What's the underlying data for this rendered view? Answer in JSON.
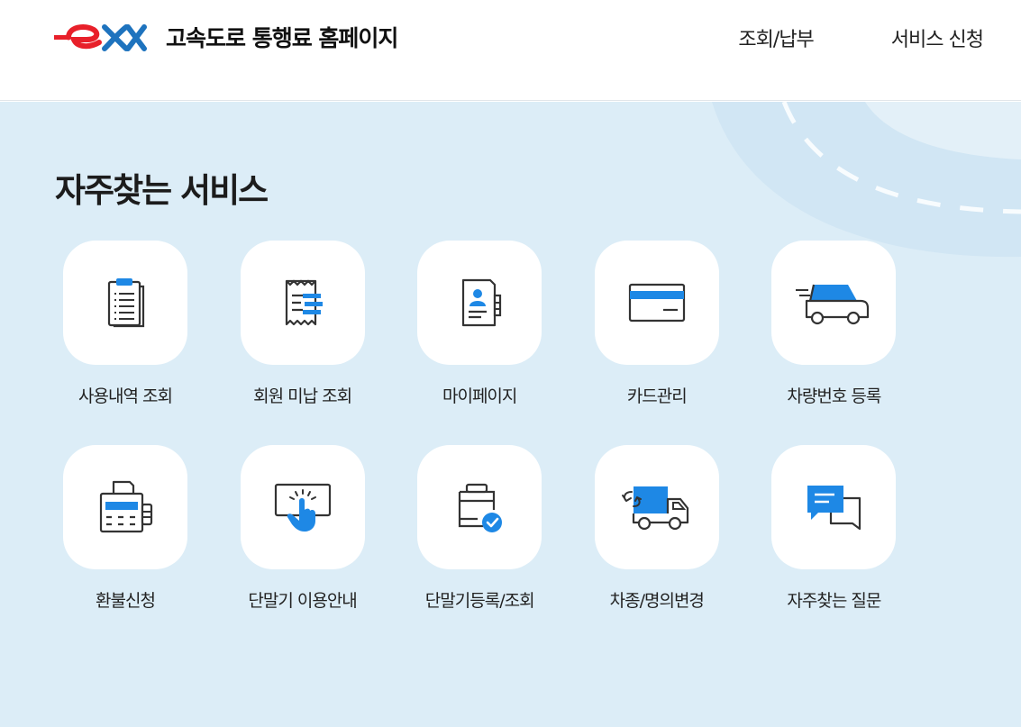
{
  "header": {
    "site_title": "고속도로 통행료 홈페이지",
    "nav": [
      "조회/납부",
      "서비스 신청"
    ]
  },
  "main": {
    "section_title": "자주찾는 서비스"
  },
  "services": [
    {
      "label": "사용내역 조회",
      "icon": "clipboard-list-icon"
    },
    {
      "label": "회원 미납 조회",
      "icon": "receipt-icon"
    },
    {
      "label": "마이페이지",
      "icon": "profile-card-icon"
    },
    {
      "label": "카드관리",
      "icon": "credit-card-icon"
    },
    {
      "label": "차량번호 등록",
      "icon": "car-icon"
    },
    {
      "label": "환불신청",
      "icon": "cash-register-icon"
    },
    {
      "label": "단말기 이용안내",
      "icon": "touch-screen-icon"
    },
    {
      "label": "단말기등록/조회",
      "icon": "device-check-icon"
    },
    {
      "label": "차종/명의변경",
      "icon": "truck-exchange-icon"
    },
    {
      "label": "자주찾는 질문",
      "icon": "chat-bubbles-icon"
    }
  ],
  "colors": {
    "accent_blue": "#1e88e5",
    "brand_red": "#e8202a",
    "brand_blue": "#1e73be",
    "background": "#dcedf7"
  }
}
